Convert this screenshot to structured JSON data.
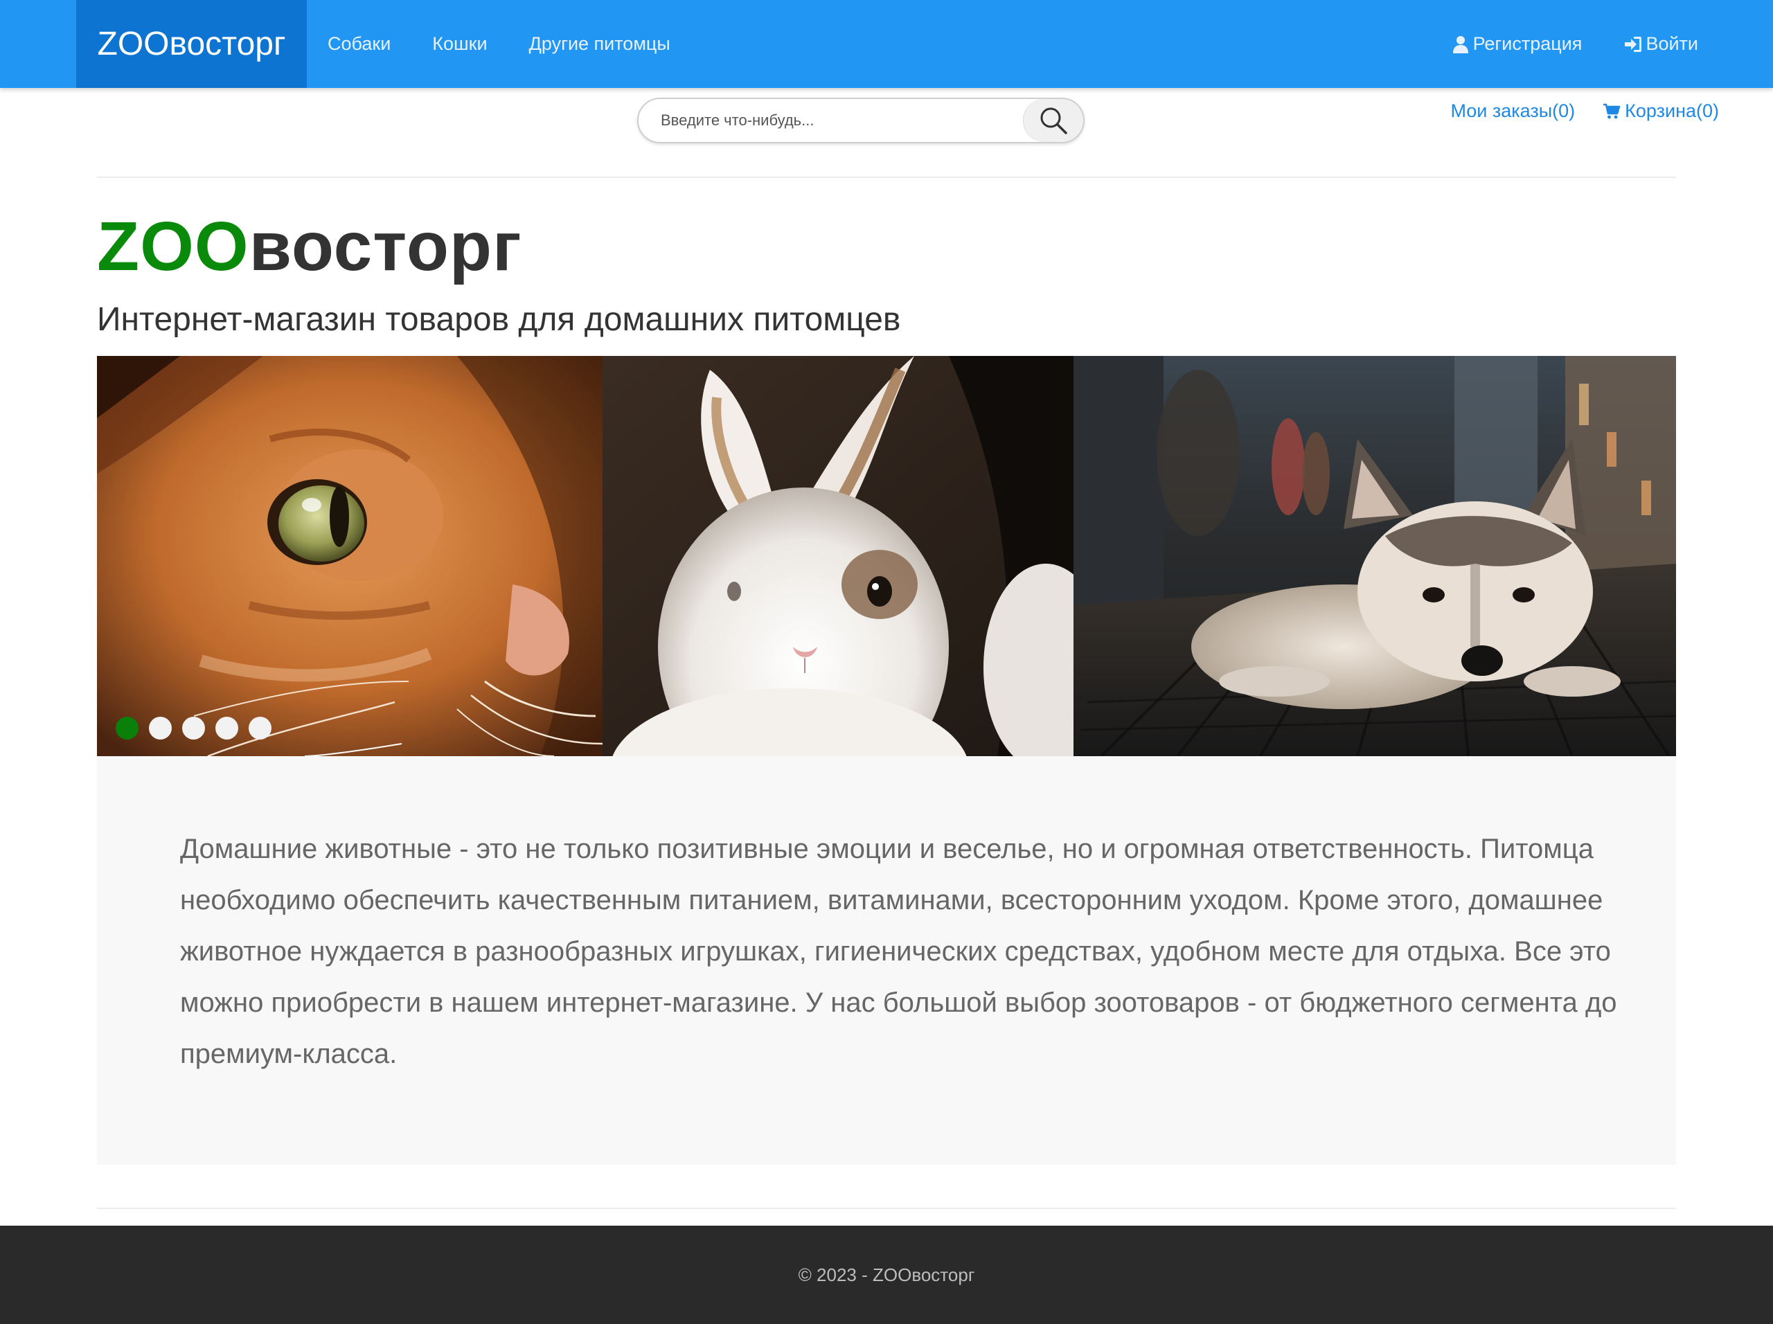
{
  "navbar": {
    "brand": "ZOOвосторг",
    "links": [
      "Собаки",
      "Кошки",
      "Другие питомцы"
    ],
    "register_label": "Регистрация",
    "login_label": "Войти",
    "bg_color": "#2196f3",
    "brand_bg_color": "#0d74d2"
  },
  "search": {
    "placeholder": "Введите что-нибудь..."
  },
  "user_links": {
    "orders_label": "Мои заказы(0)",
    "cart_label": "Корзина(0)"
  },
  "header": {
    "title_accent": "ZOO",
    "title_rest": "восторг",
    "subtitle": "Интернет-магазин товаров для домашних питомцев",
    "accent_color": "#0a8a0a"
  },
  "carousel": {
    "slide_count": 5,
    "active_index": 0,
    "panels": [
      "cat-photo",
      "rabbit-photo",
      "husky-photo"
    ]
  },
  "description": {
    "text": "Домашние животные - это не только позитивные эмоции и веселье, но и огромная ответственность. Питомца необходимо обеспечить качественным питанием, витаминами, всесторонним уходом. Кроме этого, домашнее животное нуждается в разнообразных игрушках, гигиенических средствах, удобном месте для отдыха. Все это можно приобрести в нашем интернет-магазине. У нас большой выбор зоотоваров - от бюджетного сегмента до премиум-класса."
  },
  "footer": {
    "text": "© 2023 - ZOOвосторг"
  }
}
